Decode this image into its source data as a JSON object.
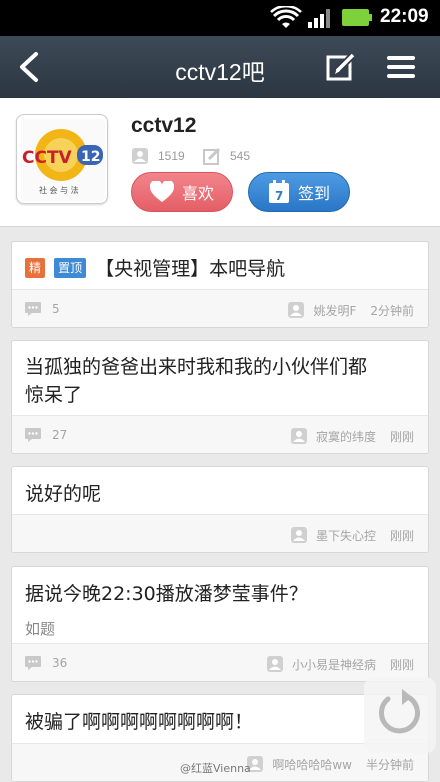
{
  "status_bar": {
    "time": "22:09",
    "battery_color": "#7fd13b"
  },
  "nav": {
    "title": "cctv12吧"
  },
  "forum": {
    "name": "cctv12",
    "logo": {
      "text": "CCTV",
      "channel": "12",
      "tagline": "社 会 与 法"
    },
    "members": "1519",
    "posts": "545",
    "like_label": "喜欢",
    "sign_label": "签到",
    "sign_day": "7"
  },
  "posts": [
    {
      "tags": [
        "精",
        "置顶"
      ],
      "title": "【央视管理】本吧导航",
      "replies": "5",
      "author": "姚发明F",
      "time": "2分钟前"
    },
    {
      "title_line1": "当孤独的爸爸出来时我和我的小伙伴们都",
      "title_line2": "惊呆了",
      "replies": "27",
      "author": "寂寞的纬度",
      "time": "刚刚"
    },
    {
      "title": "说好的呢",
      "author": "墨下失心控",
      "time": "刚刚"
    },
    {
      "title": "据说今晚22:30播放潘梦莹事件？",
      "subtitle": "如题",
      "replies": "36",
      "author": "小小易是神经病",
      "time": "刚刚"
    },
    {
      "title": "被骗了啊啊啊啊啊啊啊啊！",
      "author": "啊哈哈哈哈ww",
      "time": "半分钟前"
    }
  ],
  "watermark": "@红蓝Vienna"
}
